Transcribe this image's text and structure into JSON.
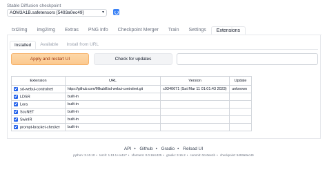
{
  "checkpoint": {
    "label": "Stable Diffusion checkpoint",
    "value": "AOM3A1B.safetensors [5493a0ec49]"
  },
  "tabs": [
    {
      "label": "txt2img"
    },
    {
      "label": "img2img"
    },
    {
      "label": "Extras"
    },
    {
      "label": "PNG Info"
    },
    {
      "label": "Checkpoint Merger"
    },
    {
      "label": "Train"
    },
    {
      "label": "Settings"
    },
    {
      "label": "Extensions"
    }
  ],
  "subtabs": [
    {
      "label": "Installed"
    },
    {
      "label": "Available"
    },
    {
      "label": "Install from URL"
    }
  ],
  "buttons": {
    "apply": "Apply and restart UI",
    "check": "Check for updates"
  },
  "table": {
    "headers": [
      "Extension",
      "URL",
      "Version",
      "Update"
    ],
    "rows": [
      {
        "name": "sd-webui-controlnet",
        "url": "https://github.com/Mikubill/sd-webui-controlnet.git",
        "version": "c9340671 (Sat Mar 11 01:01:43 2023)",
        "update": "unknown"
      },
      {
        "name": "LDSR",
        "url": "built-in",
        "version": "",
        "update": ""
      },
      {
        "name": "Lora",
        "url": "built-in",
        "version": "",
        "update": ""
      },
      {
        "name": "ScuNET",
        "url": "built-in",
        "version": "",
        "update": ""
      },
      {
        "name": "SwinIR",
        "url": "built-in",
        "version": "",
        "update": ""
      },
      {
        "name": "prompt-bracket-checker",
        "url": "built-in",
        "version": "",
        "update": ""
      }
    ]
  },
  "footer": {
    "links": [
      "API",
      "Github",
      "Gradio",
      "Reload UI"
    ],
    "info": [
      "python: 3.10.10",
      "torch: 1.13.1+cu117",
      "xformers: 0.0.16rc425",
      "gradio: 3.16.2",
      "commit: 0cc0ee1b",
      "checkpoint: 5493a0ec49"
    ]
  },
  "colors": {
    "accent": "#2563eb",
    "apply_bg": "#fbc98f",
    "apply_text": "#9a3412"
  }
}
